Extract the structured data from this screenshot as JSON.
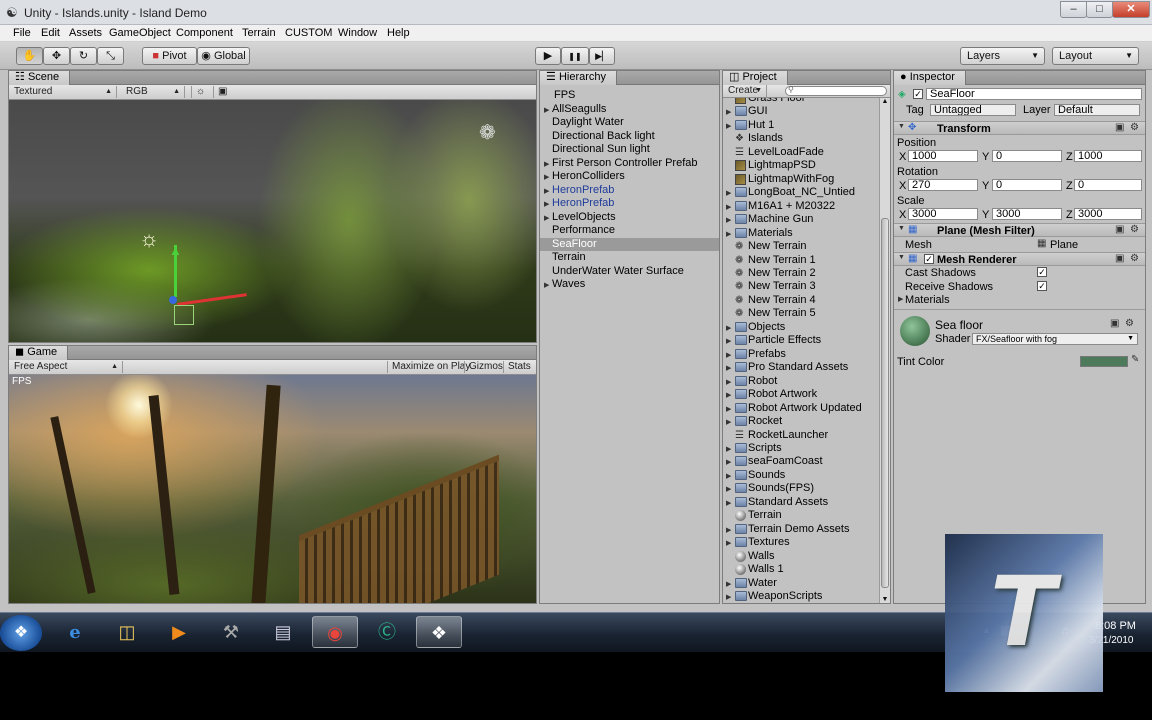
{
  "window": {
    "title": "Unity - Islands.unity - Island Demo",
    "minimize": "–",
    "maximize": "□",
    "close": "✕"
  },
  "menu": [
    "File",
    "Edit",
    "Assets",
    "GameObject",
    "Component",
    "Terrain",
    "CUSTOM",
    "Window",
    "Help"
  ],
  "toolbar": {
    "tools": [
      "✋",
      "✥",
      "↻",
      "⤡"
    ],
    "pivot": "Pivot",
    "global": "Global",
    "play": "▶",
    "pause": "❚❚",
    "step": "▶▏",
    "layers": "Layers",
    "layout": "Layout"
  },
  "scene": {
    "tab": "Scene",
    "render_mode": "Textured",
    "color_mode": "RGB"
  },
  "game": {
    "tab": "Game",
    "aspect": "Free Aspect",
    "maximize": "Maximize on Play",
    "gizmos": "Gizmos",
    "stats": "Stats",
    "fps": "FPS"
  },
  "hierarchy": {
    "tab": "Hierarchy",
    "items": [
      {
        "label": "FPS",
        "fold": false,
        "indent": 1
      },
      {
        "label": "AllSeagulls",
        "fold": true
      },
      {
        "label": "Daylight Water",
        "fold": false
      },
      {
        "label": "Directional Back light",
        "fold": false
      },
      {
        "label": "Directional Sun light",
        "fold": false
      },
      {
        "label": "First Person Controller Prefab",
        "fold": true
      },
      {
        "label": "HeronColliders",
        "fold": true
      },
      {
        "label": "HeronPrefab",
        "fold": true,
        "blue": true
      },
      {
        "label": "HeronPrefab",
        "fold": true,
        "blue": true
      },
      {
        "label": "LevelObjects",
        "fold": true
      },
      {
        "label": "Performance",
        "fold": false
      },
      {
        "label": "SeaFloor",
        "fold": false,
        "selected": true
      },
      {
        "label": "Terrain",
        "fold": false
      },
      {
        "label": "UnderWater Water Surface",
        "fold": false
      },
      {
        "label": "Waves",
        "fold": true
      }
    ]
  },
  "project": {
    "tab": "Project",
    "create": "Create",
    "items": [
      {
        "label": "Grass Floor",
        "icon": "timg"
      },
      {
        "label": "GUI",
        "icon": "folder",
        "fold": true
      },
      {
        "label": "Hut 1",
        "icon": "folder",
        "fold": true
      },
      {
        "label": "Islands",
        "icon": "unity"
      },
      {
        "label": "LevelLoadFade",
        "icon": "file"
      },
      {
        "label": "LightmapPSD",
        "icon": "timg"
      },
      {
        "label": "LightmapWithFog",
        "icon": "timg"
      },
      {
        "label": "LongBoat_NC_Untied",
        "icon": "folder",
        "fold": true
      },
      {
        "label": "M16A1 + M20322",
        "icon": "folder",
        "fold": true
      },
      {
        "label": "Machine Gun",
        "icon": "folder",
        "fold": true
      },
      {
        "label": "Materials",
        "icon": "folder",
        "fold": true
      },
      {
        "label": "New Terrain",
        "icon": "terrain"
      },
      {
        "label": "New Terrain 1",
        "icon": "terrain"
      },
      {
        "label": "New Terrain 2",
        "icon": "terrain"
      },
      {
        "label": "New Terrain 3",
        "icon": "terrain"
      },
      {
        "label": "New Terrain 4",
        "icon": "terrain"
      },
      {
        "label": "New Terrain 5",
        "icon": "terrain"
      },
      {
        "label": "Objects",
        "icon": "folder",
        "fold": true
      },
      {
        "label": "Particle Effects",
        "icon": "folder",
        "fold": true
      },
      {
        "label": "Prefabs",
        "icon": "folder",
        "fold": true
      },
      {
        "label": "Pro Standard Assets",
        "icon": "folder",
        "fold": true
      },
      {
        "label": "Robot",
        "icon": "folder",
        "fold": true
      },
      {
        "label": "Robot Artwork",
        "icon": "folder",
        "fold": true
      },
      {
        "label": "Robot Artwork Updated",
        "icon": "folder",
        "fold": true
      },
      {
        "label": "Rocket",
        "icon": "folder",
        "fold": true
      },
      {
        "label": "RocketLauncher",
        "icon": "file"
      },
      {
        "label": "Scripts",
        "icon": "folder",
        "fold": true
      },
      {
        "label": "seaFoamCoast",
        "icon": "folder",
        "fold": true
      },
      {
        "label": "Sounds",
        "icon": "folder",
        "fold": true
      },
      {
        "label": "Sounds(FPS)",
        "icon": "folder",
        "fold": true
      },
      {
        "label": "Standard Assets",
        "icon": "folder",
        "fold": true
      },
      {
        "label": "Terrain",
        "icon": "sphere"
      },
      {
        "label": "Terrain Demo Assets",
        "icon": "folder",
        "fold": true
      },
      {
        "label": "Textures",
        "icon": "folder",
        "fold": true
      },
      {
        "label": "Walls",
        "icon": "sphere"
      },
      {
        "label": "Walls 1",
        "icon": "sphere"
      },
      {
        "label": "Water",
        "icon": "folder",
        "fold": true
      },
      {
        "label": "WeaponScripts",
        "icon": "folder",
        "fold": true
      }
    ]
  },
  "inspector": {
    "tab": "Inspector",
    "object_name": "SeaFloor",
    "tag_label": "Tag",
    "tag": "Untagged",
    "layer_label": "Layer",
    "layer": "Default",
    "transform": {
      "title": "Transform",
      "position_label": "Position",
      "rotation_label": "Rotation",
      "scale_label": "Scale",
      "position": {
        "x": "1000",
        "y": "0",
        "z": "1000"
      },
      "rotation": {
        "x": "270",
        "y": "0",
        "z": "0"
      },
      "scale": {
        "x": "3000",
        "y": "3000",
        "z": "3000"
      }
    },
    "mesh_filter": {
      "title": "Plane (Mesh Filter)",
      "mesh_label": "Mesh",
      "mesh": "Plane"
    },
    "mesh_renderer": {
      "title": "Mesh Renderer",
      "cast_shadows": "Cast Shadows",
      "receive_shadows": "Receive Shadows",
      "materials": "Materials"
    },
    "material": {
      "name": "Sea floor",
      "shader_label": "Shader",
      "shader": "FX/Seafloor with fog",
      "tint_label": "Tint Color",
      "tint_color": "#4d7a5a",
      "swatch": "#4b7c55"
    }
  },
  "taskbar": {
    "time": "8:08 PM",
    "date": "3/21/2010"
  },
  "colors": {
    "accent": "#9a9a9a",
    "link_blue": "#1f3c9a"
  }
}
